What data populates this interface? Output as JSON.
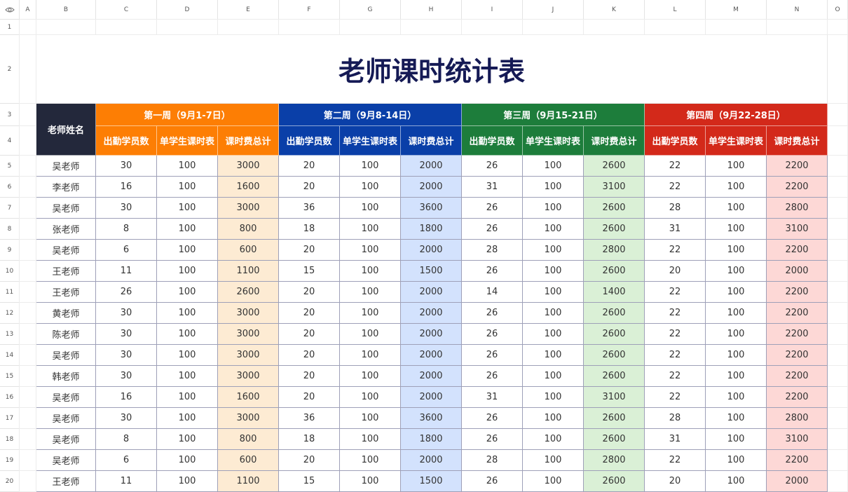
{
  "columns": [
    "A",
    "B",
    "C",
    "D",
    "E",
    "F",
    "G",
    "H",
    "I",
    "J",
    "K",
    "L",
    "M",
    "N",
    "O"
  ],
  "rows": [
    "1",
    "2",
    "3",
    "4",
    "5",
    "6",
    "7",
    "8",
    "9",
    "10",
    "11",
    "12",
    "13",
    "14",
    "15",
    "16",
    "17",
    "18",
    "19",
    "20"
  ],
  "title": "老师课时统计表",
  "name_header": "老师姓名",
  "sub_headers": [
    "出勤学员数",
    "单学生课时表",
    "课时费总计"
  ],
  "weeks": [
    {
      "label": "第一周（9月1-7日）",
      "header_color": "#fd7e04",
      "total_bg": "#fdebd3"
    },
    {
      "label": "第二周（9月8-14日）",
      "header_color": "#0a3fa8",
      "total_bg": "#d3e2fd"
    },
    {
      "label": "第三周（9月15-21日）",
      "header_color": "#1d7d3b",
      "total_bg": "#daf0d6"
    },
    {
      "label": "第四周（9月22-28日）",
      "header_color": "#d3291a",
      "total_bg": "#fdd8d6"
    }
  ],
  "name_header_color": "#23283b",
  "records": [
    {
      "name": "吴老师",
      "w": [
        [
          "30",
          "100",
          "3000"
        ],
        [
          "20",
          "100",
          "2000"
        ],
        [
          "26",
          "100",
          "2600"
        ],
        [
          "22",
          "100",
          "2200"
        ]
      ]
    },
    {
      "name": "李老师",
      "w": [
        [
          "16",
          "100",
          "1600"
        ],
        [
          "20",
          "100",
          "2000"
        ],
        [
          "31",
          "100",
          "3100"
        ],
        [
          "22",
          "100",
          "2200"
        ]
      ]
    },
    {
      "name": "吴老师",
      "w": [
        [
          "30",
          "100",
          "3000"
        ],
        [
          "36",
          "100",
          "3600"
        ],
        [
          "26",
          "100",
          "2600"
        ],
        [
          "28",
          "100",
          "2800"
        ]
      ]
    },
    {
      "name": "张老师",
      "w": [
        [
          "8",
          "100",
          "800"
        ],
        [
          "18",
          "100",
          "1800"
        ],
        [
          "26",
          "100",
          "2600"
        ],
        [
          "31",
          "100",
          "3100"
        ]
      ]
    },
    {
      "name": "吴老师",
      "w": [
        [
          "6",
          "100",
          "600"
        ],
        [
          "20",
          "100",
          "2000"
        ],
        [
          "28",
          "100",
          "2800"
        ],
        [
          "22",
          "100",
          "2200"
        ]
      ]
    },
    {
      "name": "王老师",
      "w": [
        [
          "11",
          "100",
          "1100"
        ],
        [
          "15",
          "100",
          "1500"
        ],
        [
          "26",
          "100",
          "2600"
        ],
        [
          "20",
          "100",
          "2000"
        ]
      ]
    },
    {
      "name": "王老师",
      "w": [
        [
          "26",
          "100",
          "2600"
        ],
        [
          "20",
          "100",
          "2000"
        ],
        [
          "14",
          "100",
          "1400"
        ],
        [
          "22",
          "100",
          "2200"
        ]
      ]
    },
    {
      "name": "黄老师",
      "w": [
        [
          "30",
          "100",
          "3000"
        ],
        [
          "20",
          "100",
          "2000"
        ],
        [
          "26",
          "100",
          "2600"
        ],
        [
          "22",
          "100",
          "2200"
        ]
      ]
    },
    {
      "name": "陈老师",
      "w": [
        [
          "30",
          "100",
          "3000"
        ],
        [
          "20",
          "100",
          "2000"
        ],
        [
          "26",
          "100",
          "2600"
        ],
        [
          "22",
          "100",
          "2200"
        ]
      ]
    },
    {
      "name": "吴老师",
      "w": [
        [
          "30",
          "100",
          "3000"
        ],
        [
          "20",
          "100",
          "2000"
        ],
        [
          "26",
          "100",
          "2600"
        ],
        [
          "22",
          "100",
          "2200"
        ]
      ]
    },
    {
      "name": "韩老师",
      "w": [
        [
          "30",
          "100",
          "3000"
        ],
        [
          "20",
          "100",
          "2000"
        ],
        [
          "26",
          "100",
          "2600"
        ],
        [
          "22",
          "100",
          "2200"
        ]
      ]
    },
    {
      "name": "吴老师",
      "w": [
        [
          "16",
          "100",
          "1600"
        ],
        [
          "20",
          "100",
          "2000"
        ],
        [
          "31",
          "100",
          "3100"
        ],
        [
          "22",
          "100",
          "2200"
        ]
      ]
    },
    {
      "name": "吴老师",
      "w": [
        [
          "30",
          "100",
          "3000"
        ],
        [
          "36",
          "100",
          "3600"
        ],
        [
          "26",
          "100",
          "2600"
        ],
        [
          "28",
          "100",
          "2800"
        ]
      ]
    },
    {
      "name": "吴老师",
      "w": [
        [
          "8",
          "100",
          "800"
        ],
        [
          "18",
          "100",
          "1800"
        ],
        [
          "26",
          "100",
          "2600"
        ],
        [
          "31",
          "100",
          "3100"
        ]
      ]
    },
    {
      "name": "吴老师",
      "w": [
        [
          "6",
          "100",
          "600"
        ],
        [
          "20",
          "100",
          "2000"
        ],
        [
          "28",
          "100",
          "2800"
        ],
        [
          "22",
          "100",
          "2200"
        ]
      ]
    },
    {
      "name": "王老师",
      "w": [
        [
          "11",
          "100",
          "1100"
        ],
        [
          "15",
          "100",
          "1500"
        ],
        [
          "26",
          "100",
          "2600"
        ],
        [
          "20",
          "100",
          "2000"
        ]
      ]
    }
  ]
}
